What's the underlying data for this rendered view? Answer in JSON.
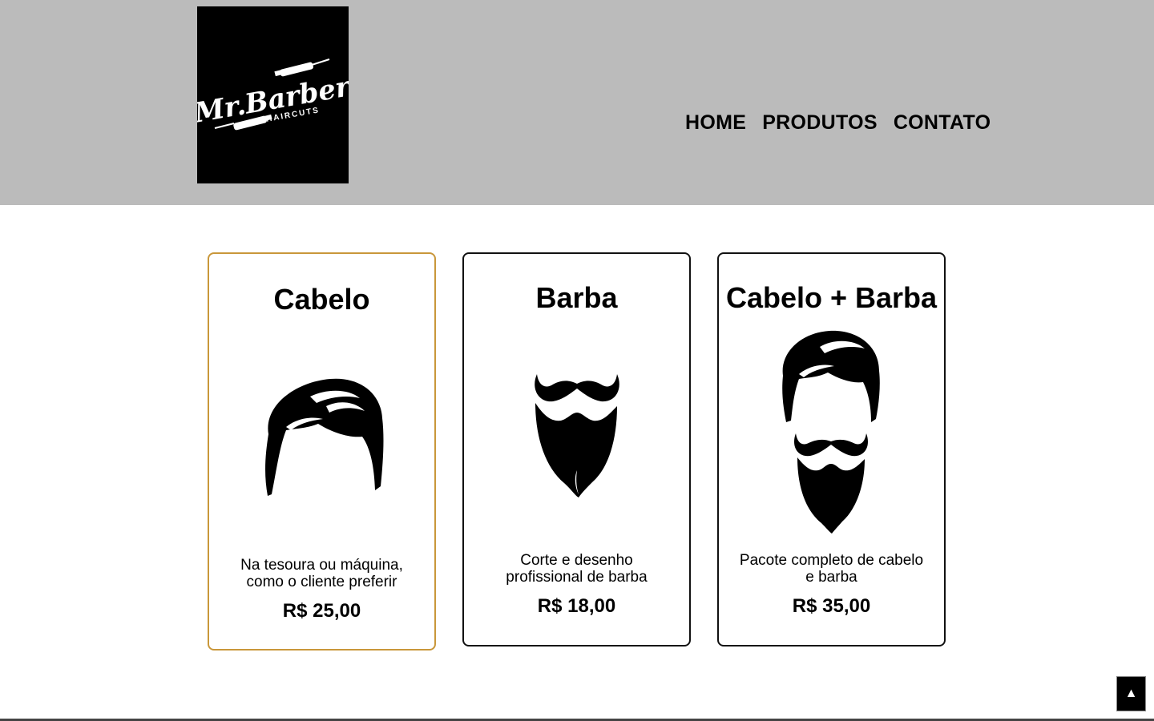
{
  "header": {
    "logo": {
      "brand": "Mr.Barber",
      "tagline": "HAIRCUTS"
    },
    "nav": [
      {
        "label": "HOME"
      },
      {
        "label": "PRODUTOS"
      },
      {
        "label": "CONTATO"
      }
    ]
  },
  "products": [
    {
      "title": "Cabelo",
      "icon": "hair-icon",
      "description": "Na tesoura ou máquina, como o cliente preferir",
      "price": "R$ 25,00",
      "highlighted": true
    },
    {
      "title": "Barba",
      "icon": "beard-icon",
      "description": "Corte e desenho profissional de barba",
      "price": "R$ 18,00",
      "highlighted": false
    },
    {
      "title": "Cabelo + Barba",
      "icon": "hair-and-beard-icon",
      "description": "Pacote completo de cabelo e barba",
      "price": "R$ 35,00",
      "highlighted": false
    }
  ],
  "back_to_top": {
    "label": "▲",
    "icon": "arrow-up-icon"
  },
  "colors": {
    "header_bg": "#bbbbbb",
    "highlight_border": "#c9973a",
    "card_border": "#111111"
  }
}
